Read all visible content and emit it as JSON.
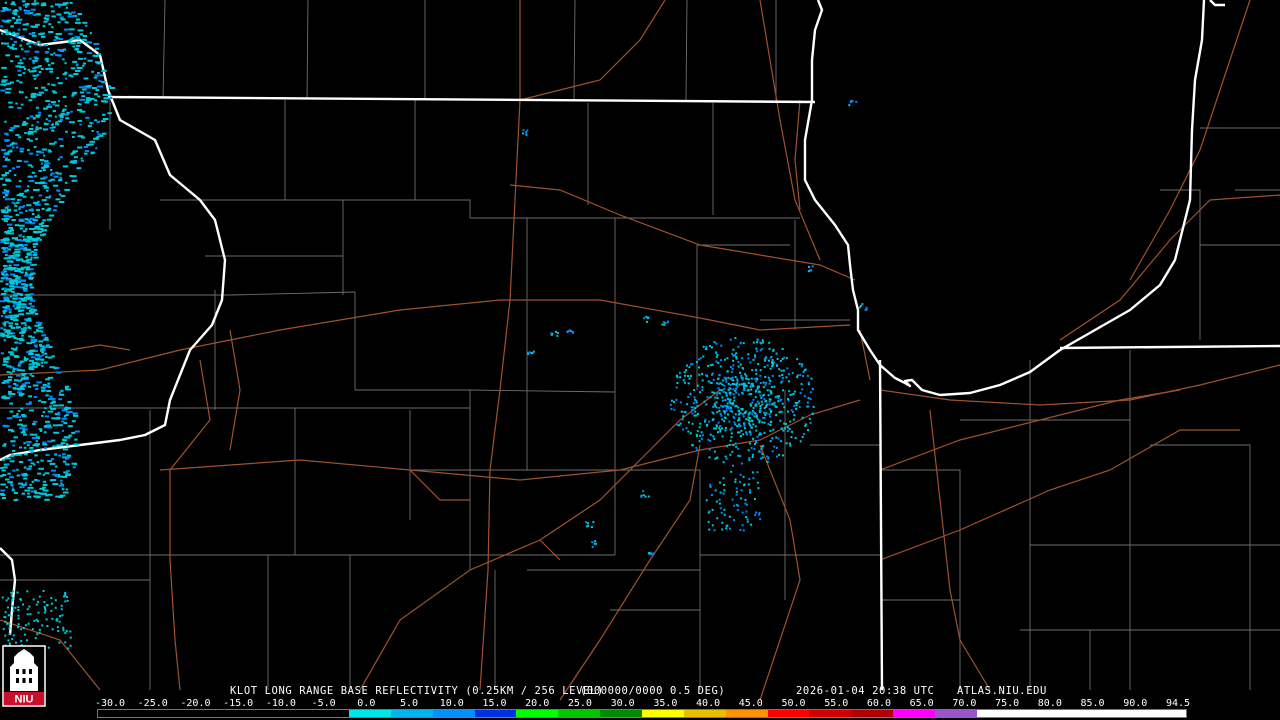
{
  "caption": {
    "station": "KLOT LONG RANGE BASE REFLECTIVITY (0.25KM / 256 LEVEL)",
    "volume": "(000000/0000 0.5 DEG)",
    "timestamp": "2026-01-04 20:38 UTC",
    "source": "ATLAS.NIU.EDU"
  },
  "legend": {
    "ticks": [
      "-30.0",
      "-25.0",
      "-20.0",
      "-15.0",
      "-10.0",
      "-5.0",
      "0.0",
      "5.0",
      "10.0",
      "15.0",
      "20.0",
      "25.0",
      "30.0",
      "35.0",
      "40.0",
      "45.0",
      "50.0",
      "55.0",
      "60.0",
      "65.0",
      "70.0",
      "75.0",
      "80.0",
      "85.0",
      "90.0",
      "94.5"
    ],
    "colors": [
      "#000000",
      "#000000",
      "#000000",
      "#000000",
      "#000000",
      "#000000",
      "#00e5e5",
      "#00b4f0",
      "#0090ff",
      "#0030e0",
      "#00ff00",
      "#00c800",
      "#008c00",
      "#ffff00",
      "#e6c000",
      "#ff9000",
      "#ff0000",
      "#d00000",
      "#b00000",
      "#ff00ff",
      "#9955c9",
      "#ffffff",
      "#ffffff",
      "#ffffff",
      "#ffffff",
      "#ffffff"
    ]
  },
  "logo": {
    "text": "NIU"
  },
  "colors": {
    "background": "#000000",
    "state_border": "#ffffff",
    "county_line": "#6e6e6e",
    "highway": "#a0522d",
    "echo_light": "#00c8d8",
    "echo_medium": "#0088ff"
  }
}
